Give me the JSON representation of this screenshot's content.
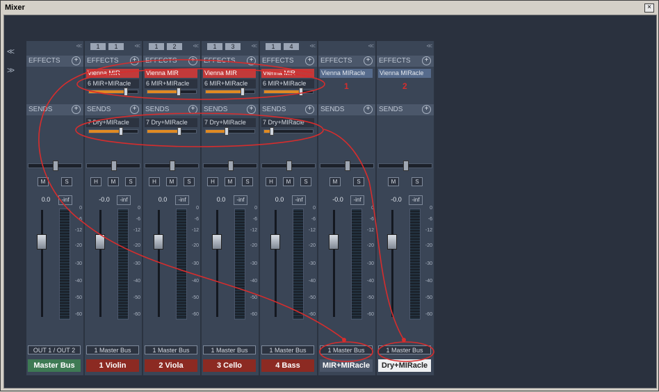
{
  "window": {
    "title": "Mixer",
    "close_symbol": "×"
  },
  "nav": {
    "left": "<<",
    "right": ">>"
  },
  "labels": {
    "effects": "EFFECTS",
    "sends": "SENDS",
    "plus": "+",
    "collapse": "<<"
  },
  "buttons": {
    "h": "H",
    "m": "M",
    "s": "S"
  },
  "scale": [
    "0",
    "-6",
    "-12",
    "-20",
    "-30",
    "-40",
    "-50",
    "-60"
  ],
  "annotations": {
    "one": "1",
    "two": "2"
  },
  "colors": {
    "annotation_red": "#d62d2d",
    "effect_active": "#c23a3a",
    "send_fill": "#e08a22",
    "master": "#3e7a54",
    "track": "#8c2a22"
  },
  "strips": [
    {
      "id": "master",
      "track": null,
      "effects": [],
      "sends": [],
      "has_h": false,
      "volume": "0.0",
      "peak": "-inf",
      "route": "OUT 1 / OUT 2",
      "name": "Master Bus",
      "style": "master"
    },
    {
      "id": "violin",
      "track": [
        "1",
        "1"
      ],
      "effects": [
        {
          "label": "Vienna MIR",
          "style": "red"
        },
        {
          "label": "6 MIR+MIRacle",
          "style": "dark",
          "level": 0.72
        }
      ],
      "sends": [
        {
          "label": "7 Dry+MIRacle",
          "level": 0.62
        }
      ],
      "has_h": true,
      "volume": "-0.0",
      "peak": "-inf",
      "route": "1 Master Bus",
      "name": "1 Violin",
      "style": "track"
    },
    {
      "id": "viola",
      "track": [
        "1",
        "2"
      ],
      "effects": [
        {
          "label": "Vienna MIR",
          "style": "red"
        },
        {
          "label": "6 MIR+MIRacle",
          "style": "dark",
          "level": 0.6
        }
      ],
      "sends": [
        {
          "label": "7 Dry+MIRacle",
          "level": 0.62
        }
      ],
      "has_h": true,
      "volume": "0.0",
      "peak": "-inf",
      "route": "1 Master Bus",
      "name": "2 Viola",
      "style": "track"
    },
    {
      "id": "cello",
      "track": [
        "1",
        "3"
      ],
      "effects": [
        {
          "label": "Vienna MIR",
          "style": "red"
        },
        {
          "label": "6 MIR+MIRacle",
          "style": "dark",
          "level": 0.72
        }
      ],
      "sends": [
        {
          "label": "7 Dry+MIRacle",
          "level": 0.38
        }
      ],
      "has_h": true,
      "volume": "0.0",
      "peak": "-inf",
      "route": "1 Master Bus",
      "name": "3 Cello",
      "style": "track"
    },
    {
      "id": "bass",
      "track": [
        "1",
        "4"
      ],
      "effects": [
        {
          "label": "Vienna MIR",
          "style": "red"
        },
        {
          "label": "6 MIR+MIRacle",
          "style": "dark",
          "level": 0.72
        }
      ],
      "sends": [
        {
          "label": "7 Dry+MIRacle",
          "level": 0.12
        }
      ],
      "has_h": true,
      "volume": "0.0",
      "peak": "-inf",
      "route": "1 Master Bus",
      "name": "4 Bass",
      "style": "track"
    },
    {
      "id": "mir-bus",
      "track": null,
      "effects": [
        {
          "label": "Vienna MIRacle",
          "style": "blue"
        }
      ],
      "sends": [],
      "has_h": false,
      "volume": "-0.0",
      "peak": "-inf",
      "route": "1 Master Bus",
      "name": "MIR+MIRacle",
      "style": "bus"
    },
    {
      "id": "dry-bus",
      "track": null,
      "effects": [
        {
          "label": "Vienna MIRacle",
          "style": "blue"
        }
      ],
      "sends": [],
      "has_h": false,
      "volume": "-0.0",
      "peak": "-inf",
      "route": "1 Master Bus",
      "name": "Dry+MIRacle",
      "style": "white"
    }
  ]
}
